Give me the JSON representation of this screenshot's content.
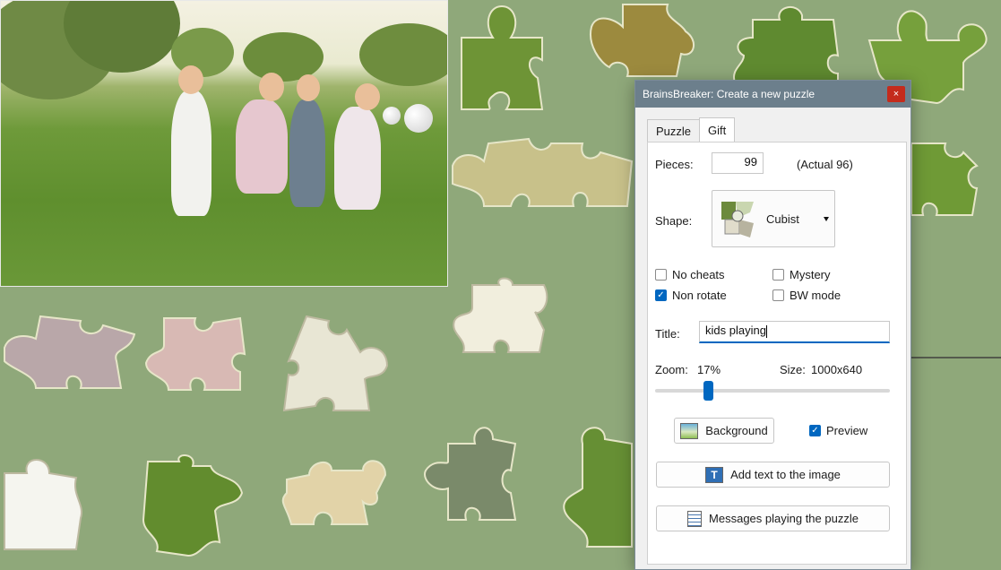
{
  "window": {
    "title": "BrainsBreaker: Create a new puzzle",
    "close_label": "×"
  },
  "tabs": [
    {
      "label": "Puzzle"
    },
    {
      "label": "Gift"
    }
  ],
  "pieces": {
    "label": "Pieces:",
    "value": "99",
    "actual": "(Actual 96)"
  },
  "shape": {
    "label": "Shape:",
    "value": "Cubist",
    "icon": "cubist-shape-icon"
  },
  "options": {
    "no_cheats": {
      "label": "No cheats",
      "checked": false
    },
    "mystery": {
      "label": "Mystery",
      "checked": false
    },
    "non_rotate": {
      "label": "Non rotate",
      "checked": true
    },
    "bw_mode": {
      "label": "BW mode",
      "checked": false
    }
  },
  "title_field": {
    "label": "Title:",
    "value": "kids playing"
  },
  "zoom": {
    "label": "Zoom:",
    "value": "17%",
    "slider_level": 0.17
  },
  "size": {
    "label": "Size:",
    "value": "1000x640"
  },
  "buttons": {
    "background": "Background",
    "preview": "Preview",
    "add_text": "Add text to the image",
    "messages": "Messages playing the puzzle"
  },
  "preview_checked": true,
  "colors": {
    "board": "#8fa87a",
    "accent": "#0067c0",
    "titlebar": "#6c7f8c"
  }
}
